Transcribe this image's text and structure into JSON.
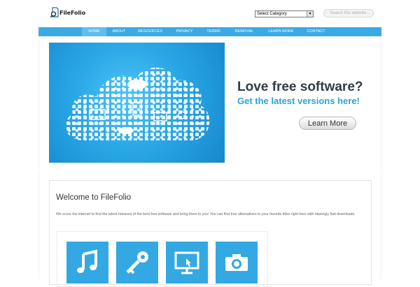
{
  "brand": {
    "logo_text": "FileFolio"
  },
  "header": {
    "category_select": "Select Category",
    "search_placeholder": "Search this website..."
  },
  "nav": {
    "items": [
      "HOME",
      "ABOUT",
      "RESOURCES",
      "PRIVACY",
      "TERMS",
      "REMOVAL",
      "LEARN MORE",
      "CONTACT"
    ],
    "active": "HOME"
  },
  "hero": {
    "title": "Love free software?",
    "subtitle": "Get the latest versions here!",
    "button": "Learn More"
  },
  "welcome": {
    "title": "Welcome to FileFolio",
    "text": "We scour the internet to find the latest releases of the best free software and bring them to you! You can find free alternatives to your favorite titles right here with blazingly fast downloads."
  },
  "tiles": [
    "music-icon",
    "key-icon",
    "monitor-icon",
    "camera-icon"
  ],
  "colors": {
    "accent": "#3aaae4",
    "tile": "#33a8e2",
    "title": "#2e3e44",
    "subtitle": "#2aa3dc"
  }
}
